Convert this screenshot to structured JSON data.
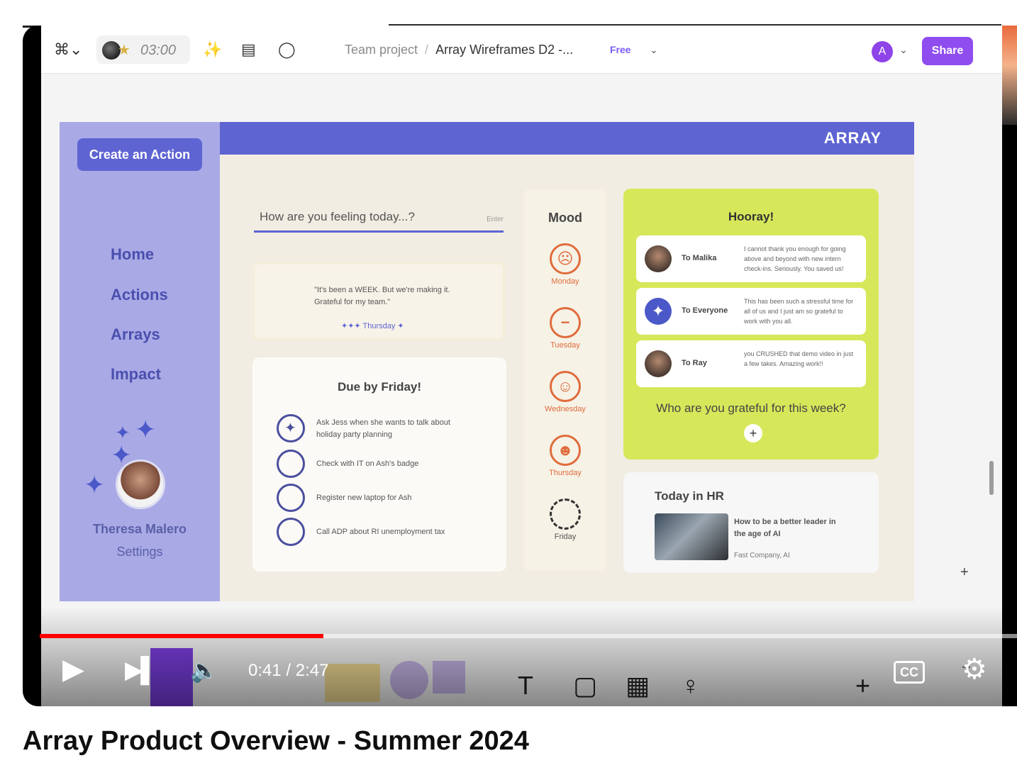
{
  "figma": {
    "timer": "03:00",
    "breadcrumb_team": "Team project",
    "breadcrumb_sep": "/",
    "file_name": "Array Wireframes D2 -...",
    "plan_badge": "Free",
    "avatar_initial": "A",
    "share_label": "Share"
  },
  "app": {
    "create_action": "Create an Action",
    "brand": "ARRAY",
    "nav": [
      "Home",
      "Actions",
      "Arrays",
      "Impact"
    ],
    "user_name": "Theresa Malero",
    "settings": "Settings",
    "feeling_placeholder": "How are you feeling today...?",
    "feeling_enter": "Enter",
    "quote_text": "\"It's been a WEEK. But we're making it. Grateful for my team.\"",
    "quote_day": "✦✦✦ Thursday ✦",
    "due_title": "Due by Friday!",
    "tasks": [
      "Ask Jess when she wants to talk about holiday party planning",
      "Check with IT on Ash's badge",
      "Register new laptop for Ash",
      "Call ADP about RI unemployment tax"
    ],
    "mood_title": "Mood",
    "moods": [
      {
        "face": "☹",
        "day": "Monday"
      },
      {
        "face": "−",
        "day": "Tuesday"
      },
      {
        "face": "☺",
        "day": "Wednesday"
      },
      {
        "face": "☻",
        "day": "Thursday"
      },
      {
        "face": "",
        "day": "Friday"
      }
    ],
    "hooray_title": "Hooray!",
    "kudos": [
      {
        "to": "To Malika",
        "msg": "I cannot thank you enough for going above and beyond with new intern check-ins. Seriously. You saved us!"
      },
      {
        "to": "To Everyone",
        "msg": "This has been such a stressful time for all of us and I just am so grateful to work with you all."
      },
      {
        "to": "To Ray",
        "msg": "you CRUSHED that demo video in just a few takes. Amazing work!!"
      }
    ],
    "grateful_prompt": "Who are you grateful for this week?",
    "hr_title": "Today in HR",
    "hr_article": "How to be a better leader in the age of AI",
    "hr_source": "Fast Company, AI"
  },
  "player": {
    "time": "0:41 / 2:47",
    "progress_fraction": 0.29,
    "cc_label": "CC"
  },
  "video_title": "Array Product Overview - Summer 2024"
}
